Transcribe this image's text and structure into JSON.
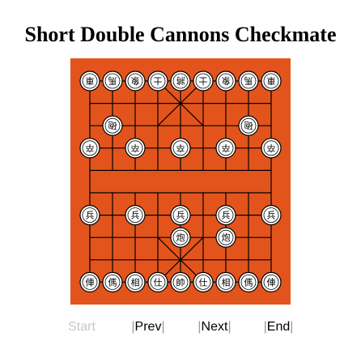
{
  "title": "Short Double Cannons Checkmate",
  "colors": {
    "board": "#e2541c",
    "grid": "#000000",
    "piece_fill": "#ffffff",
    "piece_stroke": "#000000"
  },
  "controls": {
    "start_label": "Start",
    "prev_label": "Prev",
    "next_label": "Next",
    "end_label": "End",
    "start_enabled": false
  },
  "board": {
    "files": 9,
    "ranks": 10,
    "pieces": [
      {
        "file": 0,
        "rank": 0,
        "glyph": "車",
        "side": "top"
      },
      {
        "file": 1,
        "rank": 0,
        "glyph": "馬",
        "side": "top"
      },
      {
        "file": 2,
        "rank": 0,
        "glyph": "象",
        "side": "top"
      },
      {
        "file": 3,
        "rank": 0,
        "glyph": "士",
        "side": "top"
      },
      {
        "file": 4,
        "rank": 0,
        "glyph": "將",
        "side": "top"
      },
      {
        "file": 5,
        "rank": 0,
        "glyph": "士",
        "side": "top"
      },
      {
        "file": 6,
        "rank": 0,
        "glyph": "象",
        "side": "top"
      },
      {
        "file": 7,
        "rank": 0,
        "glyph": "馬",
        "side": "top"
      },
      {
        "file": 8,
        "rank": 0,
        "glyph": "車",
        "side": "top"
      },
      {
        "file": 1,
        "rank": 2,
        "glyph": "砲",
        "side": "top"
      },
      {
        "file": 7,
        "rank": 2,
        "glyph": "砲",
        "side": "top"
      },
      {
        "file": 0,
        "rank": 3,
        "glyph": "卒",
        "side": "top"
      },
      {
        "file": 2,
        "rank": 3,
        "glyph": "卒",
        "side": "top"
      },
      {
        "file": 4,
        "rank": 3,
        "glyph": "卒",
        "side": "top"
      },
      {
        "file": 6,
        "rank": 3,
        "glyph": "卒",
        "side": "top"
      },
      {
        "file": 8,
        "rank": 3,
        "glyph": "卒",
        "side": "top"
      },
      {
        "file": 0,
        "rank": 6,
        "glyph": "兵",
        "side": "bottom"
      },
      {
        "file": 2,
        "rank": 6,
        "glyph": "兵",
        "side": "bottom"
      },
      {
        "file": 4,
        "rank": 6,
        "glyph": "兵",
        "side": "bottom"
      },
      {
        "file": 6,
        "rank": 6,
        "glyph": "兵",
        "side": "bottom"
      },
      {
        "file": 8,
        "rank": 6,
        "glyph": "兵",
        "side": "bottom"
      },
      {
        "file": 4,
        "rank": 7,
        "glyph": "炮",
        "side": "bottom"
      },
      {
        "file": 6,
        "rank": 7,
        "glyph": "炮",
        "side": "bottom"
      },
      {
        "file": 0,
        "rank": 9,
        "glyph": "俥",
        "side": "bottom"
      },
      {
        "file": 1,
        "rank": 9,
        "glyph": "傌",
        "side": "bottom"
      },
      {
        "file": 2,
        "rank": 9,
        "glyph": "相",
        "side": "bottom"
      },
      {
        "file": 3,
        "rank": 9,
        "glyph": "仕",
        "side": "bottom"
      },
      {
        "file": 4,
        "rank": 9,
        "glyph": "帥",
        "side": "bottom"
      },
      {
        "file": 5,
        "rank": 9,
        "glyph": "仕",
        "side": "bottom"
      },
      {
        "file": 6,
        "rank": 9,
        "glyph": "相",
        "side": "bottom"
      },
      {
        "file": 7,
        "rank": 9,
        "glyph": "傌",
        "side": "bottom"
      },
      {
        "file": 8,
        "rank": 9,
        "glyph": "俥",
        "side": "bottom"
      }
    ]
  }
}
